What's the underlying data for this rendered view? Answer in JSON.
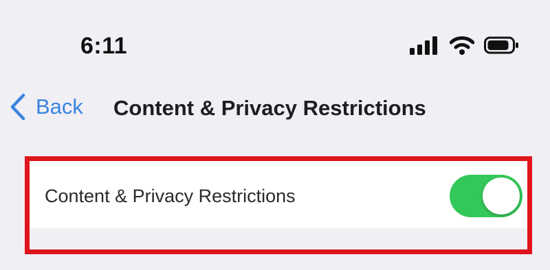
{
  "status_bar": {
    "time": "6:11",
    "icons": [
      "cellular-signal-icon",
      "wifi-icon",
      "battery-icon"
    ]
  },
  "nav": {
    "back_label": "Back",
    "title": "Content & Privacy Restrictions",
    "accent_color": "#3a83e0"
  },
  "settings": {
    "rows": [
      {
        "label": "Content & Privacy Restrictions",
        "toggle_on": true,
        "toggle_color": "#34c759"
      }
    ]
  },
  "annotation": {
    "highlight_color": "#e0141c"
  }
}
